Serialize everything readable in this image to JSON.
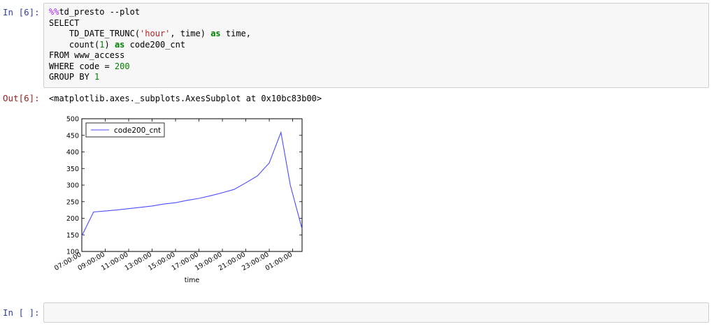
{
  "cell1": {
    "in_prompt": "In [6]:",
    "code": {
      "magic_prefix": "%%",
      "line1": "td_presto --plot",
      "line2": "SELECT",
      "line3_pre": "    TD_DATE_TRUNC(",
      "line3_str": "'hour'",
      "line3_mid": ", time) ",
      "kw_as": "as",
      "line3_post": " time,",
      "line4_pre": "    count(",
      "line4_num": "1",
      "line4_mid": ") ",
      "line4_post": " code200_cnt",
      "line5": "FROM www_access",
      "line6_pre": "WHERE code = ",
      "line6_num": "200",
      "line7_pre": "GROUP BY ",
      "line7_num": "1"
    },
    "out_prompt": "Out[6]:",
    "output_text": "<matplotlib.axes._subplots.AxesSubplot at 0x10bc83b00>"
  },
  "cell2": {
    "in_prompt": "In [ ]:"
  },
  "colors": {
    "line": "#4c4cff",
    "in_prompt": "#303f9f",
    "out_prompt": "#9b1c1c"
  },
  "chart_data": {
    "type": "line",
    "xlabel": "time",
    "ylabel": "",
    "ylim": [
      100,
      500
    ],
    "yticks": [
      100,
      150,
      200,
      250,
      300,
      350,
      400,
      450,
      500
    ],
    "x_tick_labels": [
      "07:00:00",
      "09:00:00",
      "11:00:00",
      "13:00:00",
      "15:00:00",
      "17:00:00",
      "19:00:00",
      "21:00:00",
      "23:00:00",
      "01:00:00"
    ],
    "x_tick_positions": [
      0,
      2,
      4,
      6,
      8,
      10,
      12,
      14,
      16,
      18
    ],
    "xlim": [
      0,
      18.8
    ],
    "legend": "top-left",
    "grid": false,
    "series": [
      {
        "name": "code200_cnt",
        "x": [
          0,
          1,
          2,
          3,
          4,
          5,
          6,
          7,
          8,
          9,
          10,
          11,
          12,
          13,
          14,
          15,
          16,
          17,
          17.8,
          18.8
        ],
        "values": [
          147,
          219,
          222,
          225,
          229,
          233,
          237,
          243,
          247,
          254,
          260,
          268,
          277,
          287,
          307,
          328,
          367,
          459,
          300,
          168
        ]
      }
    ]
  }
}
